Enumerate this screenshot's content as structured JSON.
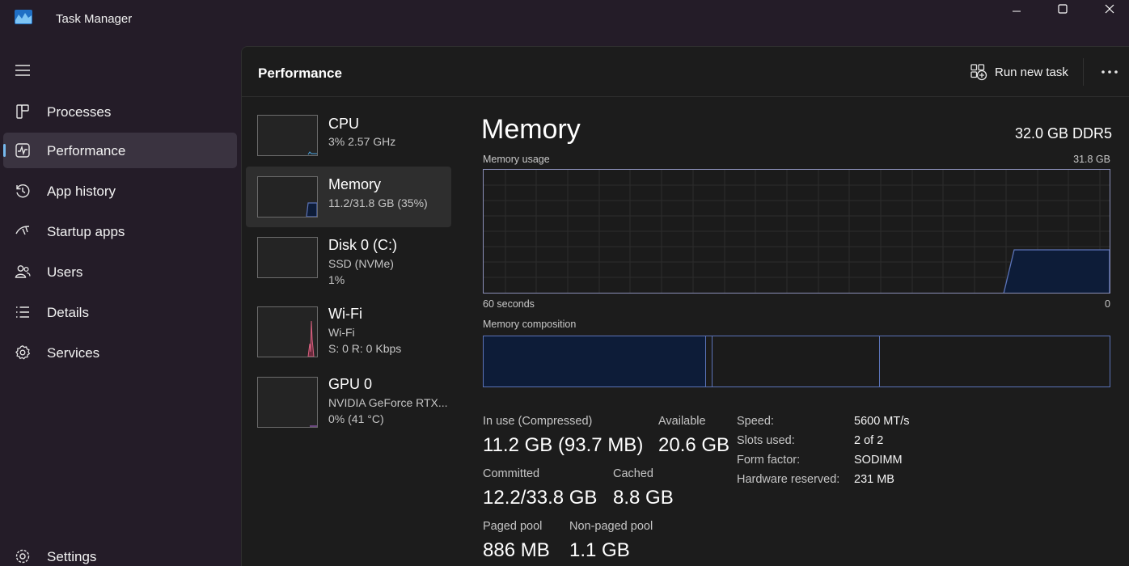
{
  "window": {
    "title": "Task Manager",
    "controls": [
      "minimize-icon",
      "maximize-icon",
      "close-icon"
    ]
  },
  "sidebar": {
    "items": [
      {
        "label": "Processes",
        "icon": "processes-icon",
        "active": false
      },
      {
        "label": "Performance",
        "icon": "performance-icon",
        "active": true
      },
      {
        "label": "App history",
        "icon": "history-icon",
        "active": false
      },
      {
        "label": "Startup apps",
        "icon": "startup-icon",
        "active": false
      },
      {
        "label": "Users",
        "icon": "users-icon",
        "active": false
      },
      {
        "label": "Details",
        "icon": "details-icon",
        "active": false
      },
      {
        "label": "Services",
        "icon": "services-icon",
        "active": false
      }
    ],
    "settings_label": "Settings"
  },
  "header": {
    "title": "Performance",
    "run_task_label": "Run new task",
    "more_icon": "more-options-icon"
  },
  "devices": [
    {
      "name": "CPU",
      "line1": "3%  2.57 GHz",
      "line2": "",
      "active": false
    },
    {
      "name": "Memory",
      "line1": "11.2/31.8 GB (35%)",
      "line2": "",
      "active": true
    },
    {
      "name": "Disk 0 (C:)",
      "line1": "SSD (NVMe)",
      "line2": "1%",
      "active": false
    },
    {
      "name": "Wi-Fi",
      "line1": "Wi-Fi",
      "line2": "S: 0 R: 0 Kbps",
      "active": false
    },
    {
      "name": "GPU 0",
      "line1": "NVIDIA GeForce RTX...",
      "line2": "0%  (41 °C)",
      "active": false
    }
  ],
  "memory": {
    "title": "Memory",
    "spec": "32.0 GB DDR5",
    "usage_label": "Memory usage",
    "usage_max": "31.8 GB",
    "time_left": "60 seconds",
    "time_right": "0",
    "composition_label": "Memory composition",
    "stats": {
      "in_use_label": "In use (Compressed)",
      "in_use_value": "11.2 GB (93.7 MB)",
      "available_label": "Available",
      "available_value": "20.6 GB",
      "committed_label": "Committed",
      "committed_value": "12.2/33.8 GB",
      "cached_label": "Cached",
      "cached_value": "8.8 GB",
      "paged_label": "Paged pool",
      "paged_value": "886 MB",
      "nonpaged_label": "Non-paged pool",
      "nonpaged_value": "1.1 GB"
    },
    "specs": [
      {
        "key": "Speed:",
        "value": "5600 MT/s"
      },
      {
        "key": "Slots used:",
        "value": "2 of 2"
      },
      {
        "key": "Form factor:",
        "value": "SODIMM"
      },
      {
        "key": "Hardware reserved:",
        "value": "231 MB"
      }
    ]
  },
  "colors": {
    "accent": "#76b9ed",
    "memory_line": "#5b73b8",
    "memory_fill": "#0d1c38",
    "wifi_line": "#d8607f"
  }
}
